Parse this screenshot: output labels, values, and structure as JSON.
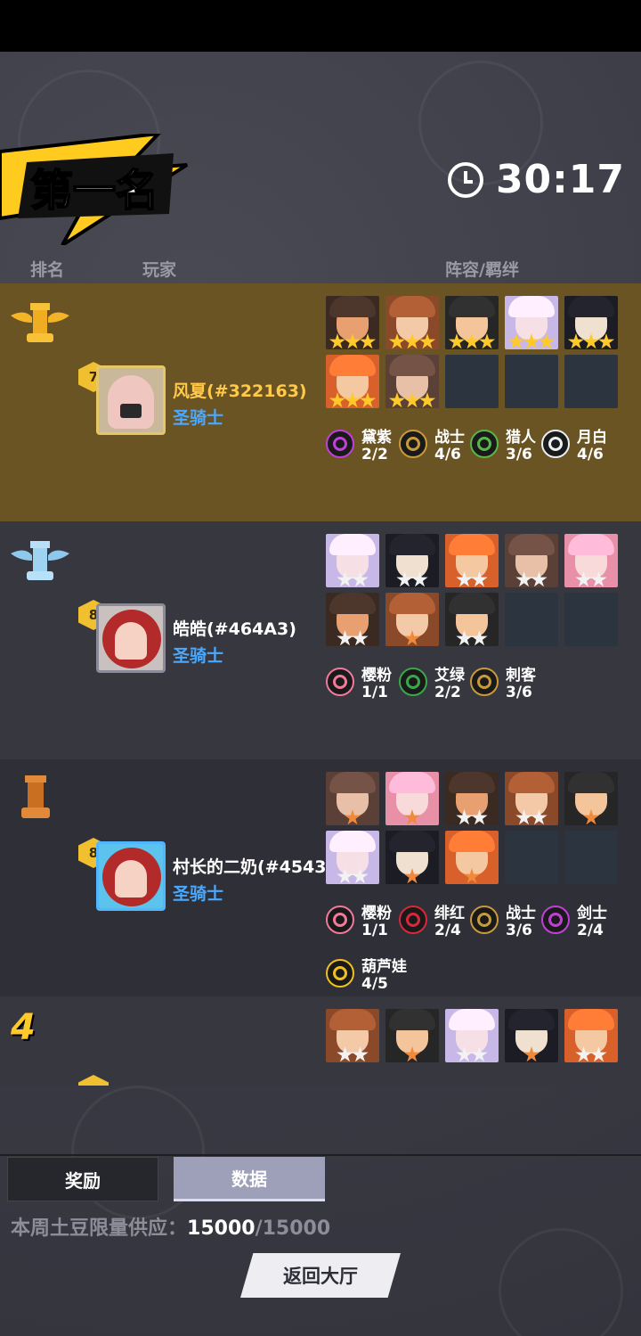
{
  "header": {
    "rank_title": "第一名",
    "timer": "30:17"
  },
  "columns": {
    "rank": "排名",
    "player": "玩家",
    "lineup": "阵容/羁绊"
  },
  "colors": {
    "gold_row": "#6b5424",
    "class_blue": "#4aa8ff",
    "accent_yellow": "#ffc928"
  },
  "rows": [
    {
      "rank_icon": "gold-rook-wings-icon",
      "level": "7",
      "level_tag": "666",
      "name": "风夏(#322163)",
      "name_color": "#ffc94a",
      "class": "圣骑士",
      "heroes": [
        {
          "stars": 3,
          "tier": "gold"
        },
        {
          "stars": 3,
          "tier": "gold"
        },
        {
          "stars": 3,
          "tier": "gold"
        },
        {
          "stars": 3,
          "tier": "gold"
        },
        {
          "stars": 3,
          "tier": "gold"
        },
        {
          "stars": 3,
          "tier": "gold"
        },
        {
          "stars": 3,
          "tier": "gold"
        }
      ],
      "bonds": [
        {
          "name": "黛紫",
          "count": "2/2",
          "icon": "purple-swirl-icon",
          "color": "#c23fd8"
        },
        {
          "name": "战士",
          "count": "4/6",
          "icon": "warrior-icon",
          "color": "#c89a3a"
        },
        {
          "name": "猎人",
          "count": "3/6",
          "icon": "bow-icon",
          "color": "#59b64a"
        },
        {
          "name": "月白",
          "count": "4/6",
          "icon": "moon-icon",
          "color": "#e8f0f4"
        }
      ]
    },
    {
      "rank_icon": "silver-rook-wings-icon",
      "level": "8",
      "name": "皓皓(#464A3)",
      "name_color": "#ffffff",
      "class": "圣骑士",
      "heroes": [
        {
          "stars": 2,
          "tier": "silver"
        },
        {
          "stars": 2,
          "tier": "silver"
        },
        {
          "stars": 2,
          "tier": "silver"
        },
        {
          "stars": 2,
          "tier": "silver"
        },
        {
          "stars": 2,
          "tier": "silver"
        },
        {
          "stars": 2,
          "tier": "silver"
        },
        {
          "stars": 1,
          "tier": "bronze"
        },
        {
          "stars": 2,
          "tier": "silver"
        }
      ],
      "bonds": [
        {
          "name": "樱粉",
          "count": "1/1",
          "icon": "sakura-icon",
          "color": "#f07a9c"
        },
        {
          "name": "艾绿",
          "count": "2/2",
          "icon": "leaf-icon",
          "color": "#3aa84a"
        },
        {
          "name": "刺客",
          "count": "3/6",
          "icon": "assassin-icon",
          "color": "#c89a3a"
        }
      ]
    },
    {
      "rank_icon": "bronze-rook-icon",
      "level": "8",
      "name": "村长的二奶(#4543",
      "name_color": "#ffffff",
      "class": "圣骑士",
      "heroes": [
        {
          "stars": 1,
          "tier": "bronze"
        },
        {
          "stars": 1,
          "tier": "bronze"
        },
        {
          "stars": 2,
          "tier": "silver"
        },
        {
          "stars": 2,
          "tier": "silver"
        },
        {
          "stars": 1,
          "tier": "bronze"
        },
        {
          "stars": 2,
          "tier": "silver"
        },
        {
          "stars": 1,
          "tier": "bronze"
        },
        {
          "stars": 1,
          "tier": "bronze"
        }
      ],
      "bonds": [
        {
          "name": "樱粉",
          "count": "1/1",
          "icon": "sakura-icon",
          "color": "#f07a9c"
        },
        {
          "name": "绯红",
          "count": "2/4",
          "icon": "crimson-icon",
          "color": "#d8283a"
        },
        {
          "name": "战士",
          "count": "3/6",
          "icon": "warrior-icon",
          "color": "#c89a3a"
        },
        {
          "name": "剑士",
          "count": "2/4",
          "icon": "sword-icon",
          "color": "#c23fd8"
        },
        {
          "name": "葫芦娃",
          "count": "4/5",
          "icon": "gourd-icon",
          "color": "#f0c020"
        }
      ]
    },
    {
      "rank_number": "4",
      "heroes": [
        {
          "stars": 2,
          "tier": "silver"
        },
        {
          "stars": 1,
          "tier": "bronze"
        },
        {
          "stars": 2,
          "tier": "silver"
        },
        {
          "stars": 1,
          "tier": "bronze"
        },
        {
          "stars": 2,
          "tier": "silver"
        }
      ]
    }
  ],
  "tabs": {
    "reward": "奖励",
    "data": "数据"
  },
  "supply": {
    "label": "本周土豆限量供应：",
    "current": "15000",
    "max": "/15000"
  },
  "back_button": "返回大厅"
}
